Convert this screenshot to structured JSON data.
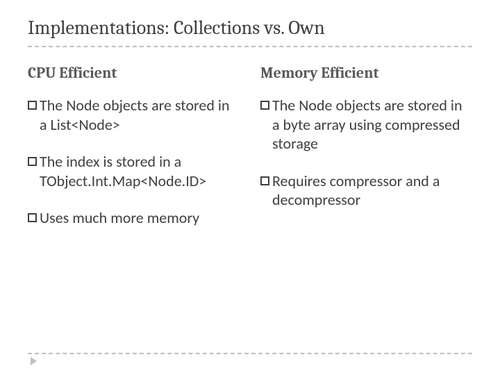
{
  "title": "Implementations: Collections vs. Own",
  "left": {
    "heading": "CPU Efficient",
    "items": [
      "The Node objects are stored in a List<Node>",
      "The index is stored in a TObject.Int.Map<Node.ID>",
      "Uses much more memory"
    ]
  },
  "right": {
    "heading": "Memory Efficient",
    "items": [
      "The Node objects are stored in a byte array using compressed storage",
      "Requires compressor and a decompressor"
    ]
  }
}
